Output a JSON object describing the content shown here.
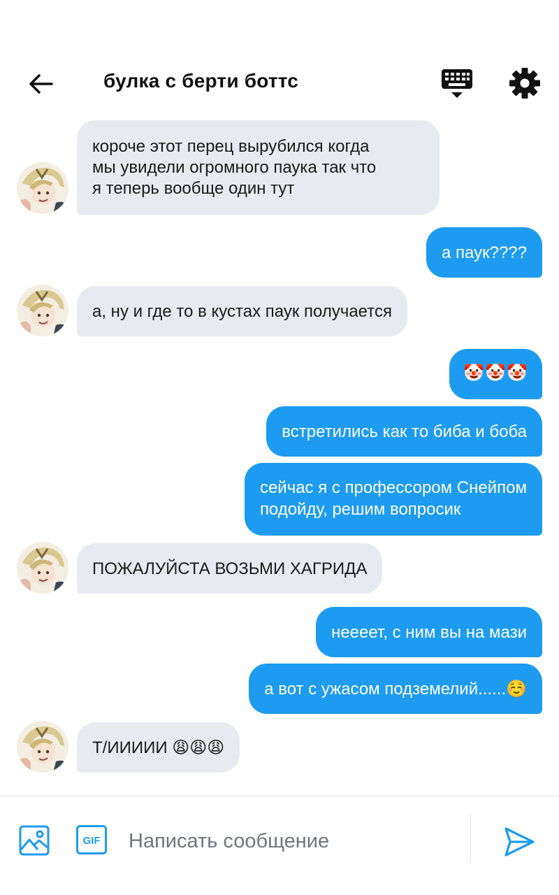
{
  "header": {
    "title": "булка с берти боттс"
  },
  "messages": [
    {
      "id": "m1",
      "side": "in",
      "text": "короче этот перец вырубился когда\nмы увидели огромного паука так что\nя теперь вообще один тут"
    },
    {
      "id": "m2",
      "side": "out",
      "text": "а паук????"
    },
    {
      "id": "m3",
      "side": "in",
      "text": "а, ну и где то в кустах паук получается"
    },
    {
      "id": "m4",
      "side": "out",
      "text": "🤡🤡🤡"
    },
    {
      "id": "m5",
      "side": "out",
      "text": "встретились как то биба и боба"
    },
    {
      "id": "m6",
      "side": "out",
      "text": "сейчас я с профессором Снейпом\nподойду, решим вопросик"
    },
    {
      "id": "m7",
      "side": "in",
      "text": "ПОЖАЛУЙСТА ВОЗЬМИ ХАГРИДА"
    },
    {
      "id": "m8",
      "side": "out",
      "text": "неееет, с ним вы на мази"
    },
    {
      "id": "m9",
      "side": "out",
      "text": "а вот с ужасом подземелий......☺️"
    },
    {
      "id": "m10",
      "side": "in",
      "text": "Т/ИИИИИ 😩😩😩"
    }
  ],
  "composer": {
    "placeholder": "Написать сообщение",
    "value": "",
    "gif_label": "GIF"
  },
  "colors": {
    "accent": "#1d9bf0",
    "incoming_bubble": "#e8eaf0",
    "outgoing_text": "#ffffff",
    "incoming_text": "#1a1a1a"
  },
  "icons": {
    "back": "arrow-left-icon",
    "keyboard": "keyboard-icon",
    "settings": "gear-icon",
    "image": "image-icon",
    "gif": "gif-icon",
    "send": "send-icon"
  }
}
